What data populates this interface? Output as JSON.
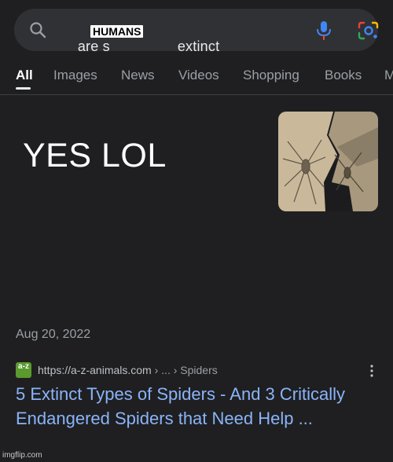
{
  "search": {
    "query_prefix": "are s",
    "query_suffix": "extinct",
    "overlay_word": "HUMANS"
  },
  "tabs": [
    "All",
    "Images",
    "News",
    "Videos",
    "Shopping",
    "Books",
    "M"
  ],
  "active_tab": "All",
  "answer": {
    "text": "YES LOL",
    "thumbnail_alt": "fossil spider image"
  },
  "result": {
    "date": "Aug 20, 2022",
    "favicon_text": "a-z",
    "url_base": "https://a-z-animals.com",
    "url_path": " › ... › Spiders",
    "title": "5 Extinct Types of Spiders - And 3 Critically Endangered Spiders that Need Help ..."
  },
  "watermark": "imgflip.com",
  "colors": {
    "background": "#1f1f21",
    "searchbar": "#303134",
    "link": "#8ab4f8",
    "muted": "#9aa0a6"
  }
}
